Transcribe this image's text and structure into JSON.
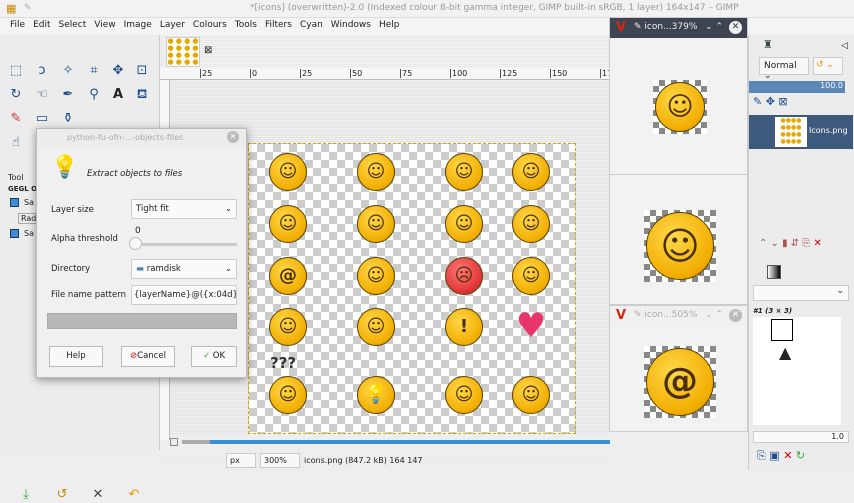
{
  "window": {
    "title": "*[icons] (overwritten)-2.0 (Indexed colour 8-bit gamma integer, GIMP built-in sRGB, 1 layer) 164x147 – GIMP"
  },
  "menu": [
    "File",
    "Edit",
    "Select",
    "View",
    "Image",
    "Layer",
    "Colours",
    "Tools",
    "Filters",
    "Cyan",
    "Windows",
    "Help"
  ],
  "toolbox": {
    "tab_label": "Tool",
    "gegl_label": "GEGL O",
    "items": [
      "Sa",
      "Radi",
      "Sa"
    ]
  },
  "ruler": {
    "ticks": [
      "25",
      "0",
      "25",
      "50",
      "75",
      "100",
      "125",
      "150",
      "175"
    ]
  },
  "canvas": {
    "emoji": [
      "☺",
      "☺",
      "☺",
      "☺",
      "☺",
      "☺",
      "☺",
      "☺",
      "@",
      "☺",
      "☹",
      "☺",
      "☺",
      "☺",
      "!",
      "♥",
      "☺",
      "💡",
      "☺",
      "☺"
    ],
    "question_marks": "???",
    "accent": "#f2ad00"
  },
  "status": {
    "unit": "px",
    "zoom": "300%",
    "info": "icons.png (847.2 kB) 164 147"
  },
  "dialog": {
    "title": "python-fu-ofn-...-objects-files",
    "heading": "Extract objects to files",
    "layer_size_label": "Layer size",
    "layer_size_value": "Tight fit",
    "alpha_label": "Alpha threshold",
    "alpha_value": "0",
    "directory_label": "Directory",
    "directory_value": "ramdisk",
    "pattern_label": "File name pattern",
    "pattern_value": "{layerName}@({x:04d},{",
    "help": "Help",
    "cancel": "Cancel",
    "ok": "OK"
  },
  "preview_windows": [
    {
      "title": "icon...379%"
    },
    {
      "title": "icon...505%"
    }
  ],
  "dock": {
    "mode": "Normal",
    "opacity": "100.0",
    "layer_name": "Icons.png",
    "brush_label": "#1 (3 × 3)",
    "spacing": "1.0"
  }
}
